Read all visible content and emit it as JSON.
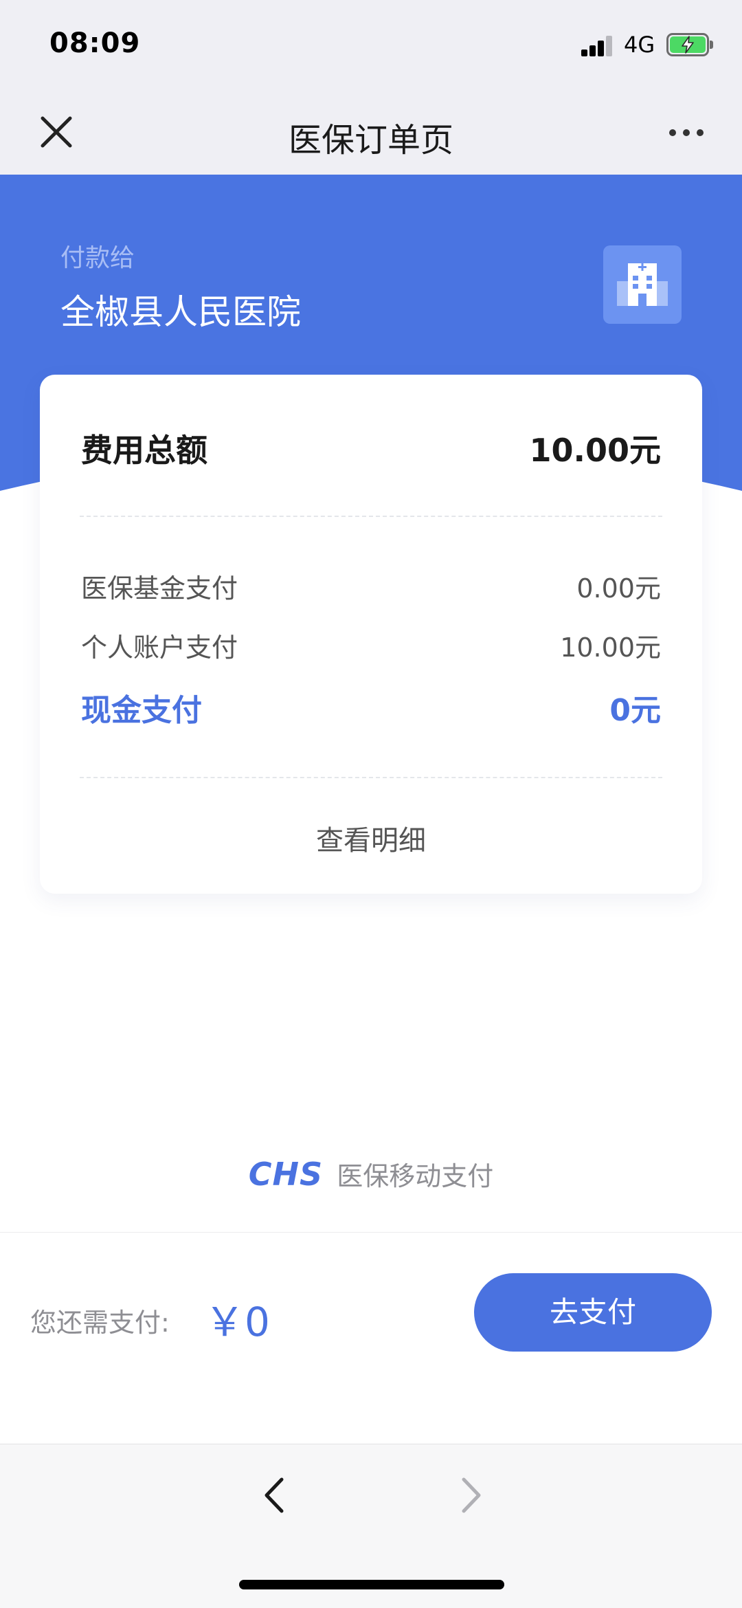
{
  "status_bar": {
    "time": "08:09",
    "network": "4G",
    "icons": [
      "signal-icon",
      "battery-charging-icon"
    ]
  },
  "nav": {
    "title": "医保订单页",
    "icons": [
      "close-icon",
      "more-icon"
    ]
  },
  "header": {
    "pay_to_label": "付款给",
    "hospital_name": "全椒县人民医院",
    "icon": "hospital-icon"
  },
  "card": {
    "total_label": "费用总额",
    "total_value": "10.00元",
    "rows": [
      {
        "label": "医保基金支付",
        "value": "0.00元"
      },
      {
        "label": "个人账户支付",
        "value": "10.00元"
      },
      {
        "label": "现金支付",
        "value": "0元"
      }
    ],
    "detail_link": "查看明细"
  },
  "brand": {
    "logo": "CHS",
    "text": "医保移动支付"
  },
  "pay_bar": {
    "remaining_label": "您还需支付:",
    "remaining_amount": "￥0",
    "pay_button": "去支付"
  },
  "browser": {
    "icons": [
      "back-icon",
      "forward-icon"
    ]
  },
  "colors": {
    "accent": "#4a72e0",
    "header_blue": "#4a74e1",
    "page_bg": "#ffffff",
    "bar_bg": "#efeff4"
  }
}
